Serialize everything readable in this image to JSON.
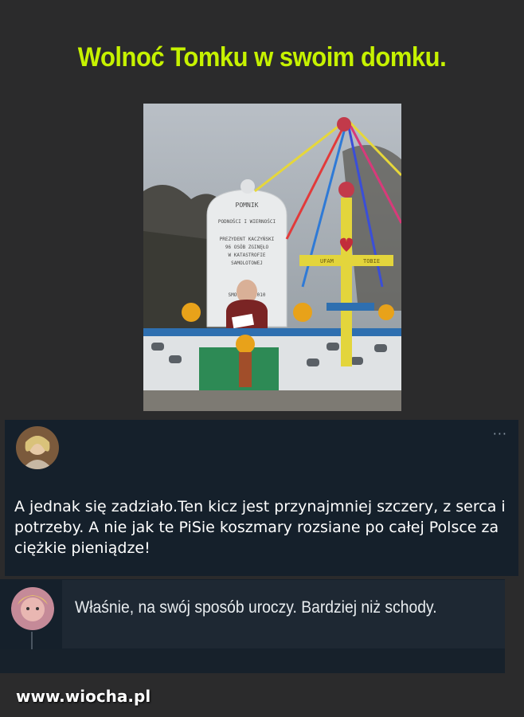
{
  "headline": "Wolnoć Tomku w swoim domku.",
  "photo": {
    "description_icon": "shrine-photo",
    "monument_lines": [
      "POMNIK",
      "PODNOŚCI I WIERNOŚCI",
      "PREZYDENT KACZYŃSKI",
      "96 OSÓB ZGINĘŁO",
      "W KATASTROFIE",
      "SAMOLOTOWEJ",
      "SMOLEŃSK 2010"
    ],
    "cross_label_left": "UFAM",
    "cross_label_right": "TOBIE"
  },
  "post": {
    "more_label": "···",
    "text": "A jednak się zadziało.Ten kicz jest przynajmniej szczery, z serca i potrzeby. A nie jak te PiSie koszmary rozsiane po całej Polsce za ciężkie pieniądze!"
  },
  "reply": {
    "text": "Właśnie, na swój sposób uroczy. Bardziej niż schody."
  },
  "watermark": "www.wiocha.pl",
  "colors": {
    "headline": "#c6f200",
    "background": "#2b2b2c",
    "post_bg": "#15202b"
  }
}
